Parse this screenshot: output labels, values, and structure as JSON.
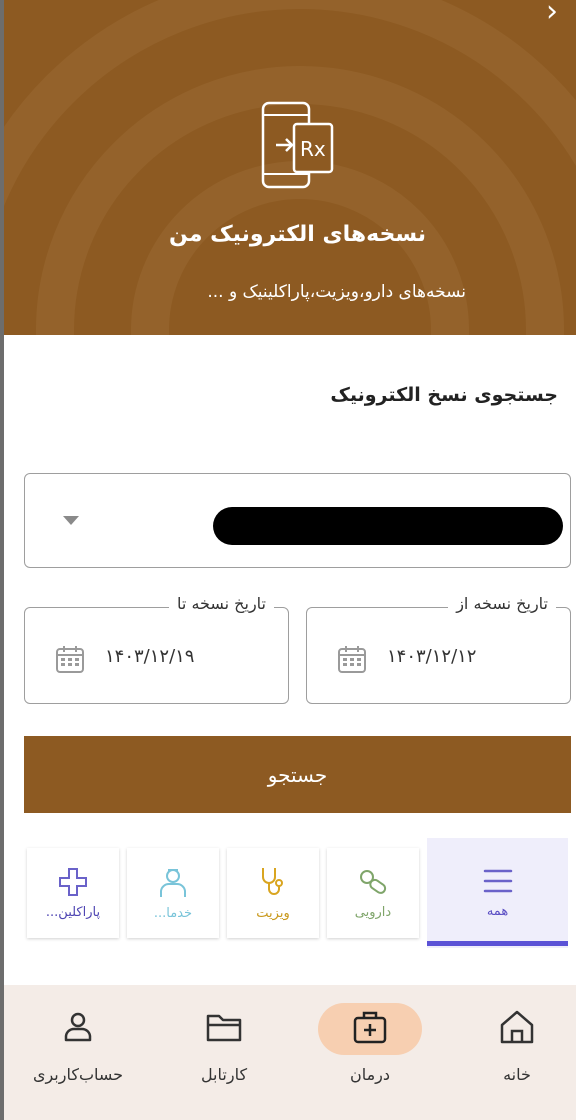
{
  "header": {
    "title": "نسخه‌های الکترونیک من",
    "subtitle": "نسخه‌های دارو،ویزیت،پاراکلینیک و ..."
  },
  "search": {
    "title": "جستجوی نسخ الکترونیک",
    "from_label": "تاریخ نسخه از",
    "from_value": "۱۴۰۳/۱۲/۱۲",
    "to_label": "تاریخ نسخه تا",
    "to_value": "۱۴۰۳/۱۲/۱۹",
    "button_label": "جستجو"
  },
  "filters": [
    {
      "label": "همه",
      "icon": "menu-icon"
    },
    {
      "label": "دارویی",
      "icon": "pill-icon"
    },
    {
      "label": "ویزیت",
      "icon": "stethoscope-icon"
    },
    {
      "label": "خدما...",
      "icon": "doctor-icon"
    },
    {
      "label": "پاراکلین...",
      "icon": "plus-icon"
    }
  ],
  "nav": [
    {
      "label": "خانه",
      "icon": "home-icon"
    },
    {
      "label": "درمان",
      "icon": "medical-kit-icon"
    },
    {
      "label": "کارتابل",
      "icon": "folder-icon"
    },
    {
      "label": "حساب‌کاربری",
      "icon": "user-icon"
    }
  ],
  "colors": {
    "brand": "#8d5a22",
    "accent": "#5b52d6",
    "nav_bg": "#f4ece7",
    "nav_active": "#f7cfb1"
  }
}
